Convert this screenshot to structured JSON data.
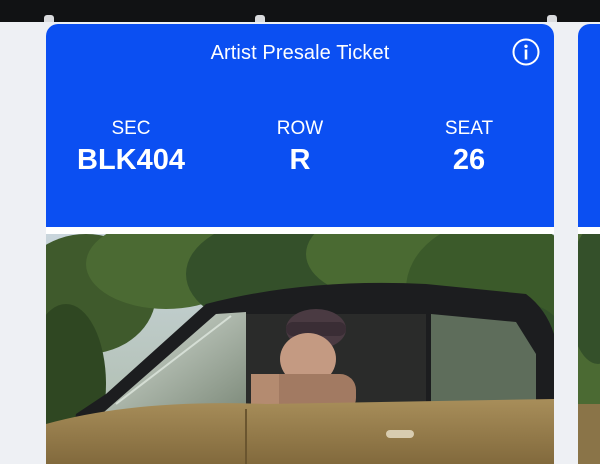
{
  "ticket": {
    "title": "Artist Presale Ticket",
    "section": {
      "label": "SEC",
      "value": "BLK404"
    },
    "row": {
      "label": "ROW",
      "value": "R"
    },
    "seat": {
      "label": "SEAT",
      "value": "26"
    },
    "info_icon": "info-circle-icon",
    "photo_icon": "event-photo"
  },
  "colors": {
    "header_blue": "#0b4ff2",
    "top_bar": "#111214",
    "page_bg": "#eef0f4",
    "text_white": "#ffffff"
  }
}
